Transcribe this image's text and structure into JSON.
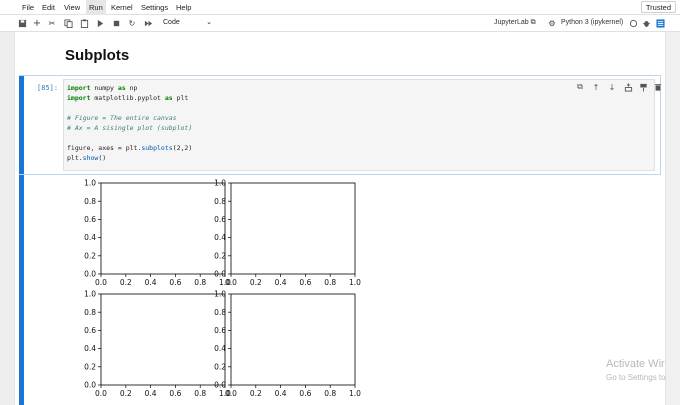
{
  "menu": [
    "File",
    "Edit",
    "View",
    "Run",
    "Kernel",
    "Settings",
    "Help"
  ],
  "active_menu": "Run",
  "trusted_label": "Trusted",
  "toolbar": {
    "cell_type": "Code",
    "jupyterlab_link": "JupyterLab",
    "kernel": "Python 3 (ipykernel)"
  },
  "notebook": {
    "heading": "Subplots",
    "cell_prompt": "[85]:",
    "code_lines": [
      [
        "kw:import",
        "tx: numpy ",
        "kw:as",
        "tx: np"
      ],
      [
        "kw:import",
        "tx: matplotlib.pyplot ",
        "kw:as",
        "tx: plt"
      ],
      [],
      [
        "cm:# Figure = The entire canvas"
      ],
      [
        "cm:# Ax = A sisingle plot (subplot)"
      ],
      [],
      [
        "tx:figure, axes = plt.",
        "fn:subplots",
        "tx:(2,2)"
      ],
      [
        "tx:plt.",
        "fn:show",
        "tx:()"
      ]
    ]
  },
  "watermark": {
    "line1": "Activate Wir",
    "line2": "Go to Settings to"
  },
  "chart_data": [
    {
      "type": "scatter",
      "position": "top-left",
      "xlim": [
        0.0,
        1.0
      ],
      "ylim": [
        0.0,
        1.0
      ],
      "xticks": [
        "0.0",
        "0.2",
        "0.4",
        "0.6",
        "0.8",
        "1.0"
      ],
      "yticks": [
        "0.0",
        "0.2",
        "0.4",
        "0.6",
        "0.8",
        "1.0"
      ],
      "series": []
    },
    {
      "type": "scatter",
      "position": "top-right",
      "xlim": [
        0.0,
        1.0
      ],
      "ylim": [
        0.0,
        1.0
      ],
      "xticks": [
        "0.0",
        "0.2",
        "0.4",
        "0.6",
        "0.8",
        "1.0"
      ],
      "yticks": [
        "0.0",
        "0.2",
        "0.4",
        "0.6",
        "0.8",
        "1.0"
      ],
      "series": []
    },
    {
      "type": "scatter",
      "position": "bottom-left",
      "xlim": [
        0.0,
        1.0
      ],
      "ylim": [
        0.0,
        1.0
      ],
      "xticks": [
        "0.0",
        "0.2",
        "0.4",
        "0.6",
        "0.8",
        "1.0"
      ],
      "yticks": [
        "0.0",
        "0.2",
        "0.4",
        "0.6",
        "0.8",
        "1.0"
      ],
      "series": []
    },
    {
      "type": "scatter",
      "position": "bottom-right",
      "xlim": [
        0.0,
        1.0
      ],
      "ylim": [
        0.0,
        1.0
      ],
      "xticks": [
        "0.0",
        "0.2",
        "0.4",
        "0.6",
        "0.8",
        "1.0"
      ],
      "yticks": [
        "0.0",
        "0.2",
        "0.4",
        "0.6",
        "0.8",
        "1.0"
      ],
      "series": []
    }
  ]
}
